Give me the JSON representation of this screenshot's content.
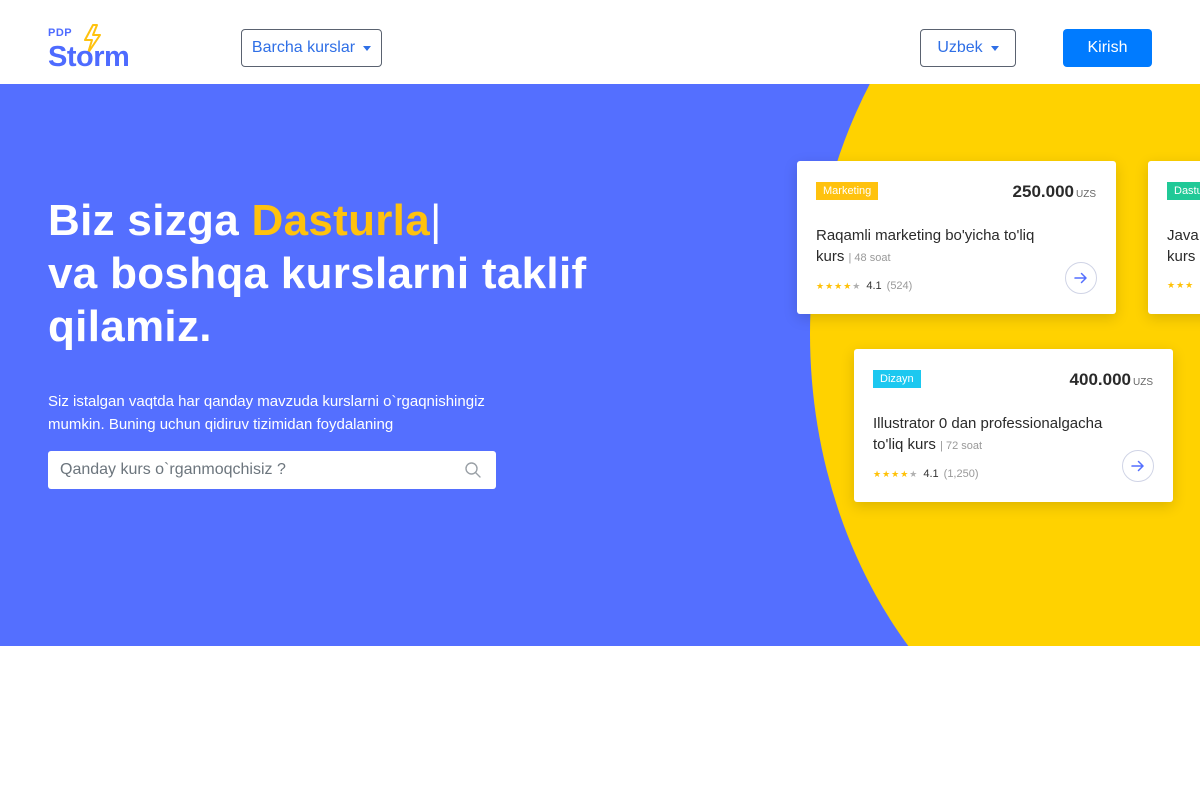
{
  "logo": {
    "small": "PDP",
    "big": "Storm"
  },
  "nav": {
    "courses_label": "Barcha kurslar",
    "language_label": "Uzbek",
    "login_label": "Kirish"
  },
  "hero": {
    "title_prefix": "Biz sizga ",
    "title_highlight": "Dasturla",
    "title_cursor": "|",
    "title_rest": "va boshqa kurslarni taklif qilamiz.",
    "description": "Siz istalgan vaqtda har qanday mavzuda kurslarni o`rgaqnishingiz mumkin. Buning uchun qidiruv tizimidan foydalaning",
    "search_placeholder": "Qanday kurs o`rganmoqchisiz ?"
  },
  "colors": {
    "hero_bg": "#546fff",
    "accent_yellow": "#ffd200",
    "highlight": "#ffc20e",
    "primary": "#007bff"
  },
  "cards": [
    {
      "tag": "Marketing",
      "price": "250.000",
      "currency": "UZS",
      "title": "Raqamli marketing bo'yicha to'liq kurs",
      "hours": "| 48 soat",
      "rating": "4.1",
      "reviews": "(524)",
      "stars_filled": 4
    },
    {
      "tag": "Dizayn",
      "price": "400.000",
      "currency": "UZS",
      "title": "Illustrator 0 dan professionalgacha to'liq kurs",
      "hours": "| 72 soat",
      "rating": "4.1",
      "reviews": "(1,250)",
      "stars_filled": 4
    },
    {
      "tag": "Dastu",
      "title_line1": "Java",
      "title_line2": "kurs"
    }
  ]
}
